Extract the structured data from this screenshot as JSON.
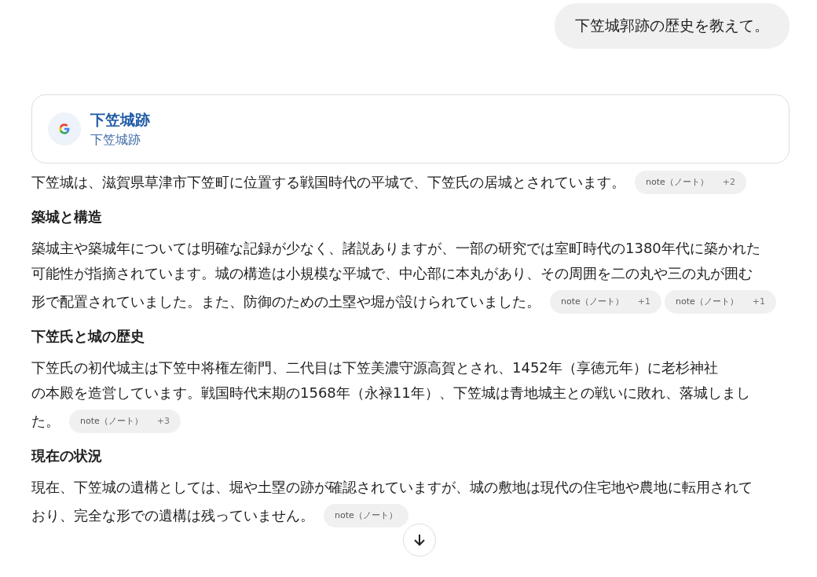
{
  "user_message": "下笠城郭跡の歴史を教えて。",
  "source_card": {
    "title": "下笠城跡",
    "subtitle": "下笠城跡"
  },
  "blocks": [
    {
      "kind": "para",
      "lines": [
        "下笠城は、滋賀県草津市下笠町に位置する戦国時代の平城で、下笠氏の居城とされています。"
      ],
      "citations": [
        {
          "source": "note（ノート）",
          "count": "+2"
        }
      ]
    },
    {
      "kind": "heading",
      "text": "築城と構造"
    },
    {
      "kind": "para",
      "lines": [
        "築城主や築城年については明確な記録が少なく、諸説ありますが、一部の研究では室町時代の1380年代に築かれた",
        "可能性が指摘されています。城の構造は小規模な平城で、中心部に本丸があり、その周囲を二の丸や三の丸が囲む",
        "形で配置されていました。また、防御のための土塁や堀が設けられていました。"
      ],
      "citations": [
        {
          "source": "note（ノート）",
          "count": "+1"
        },
        {
          "source": "note（ノート）",
          "count": "+1"
        }
      ]
    },
    {
      "kind": "heading",
      "text": "下笠氏と城の歴史"
    },
    {
      "kind": "para",
      "lines": [
        "下笠氏の初代城主は下笠中将権左衛門、二代目は下笠美濃守源高賀とされ、1452年（享徳元年）に老杉神社",
        "の本殿を造営しています。戦国時代末期の1568年（永禄11年）、下笠城は青地城主との戦いに敗れ、落城しまし",
        "た。"
      ],
      "citations": [
        {
          "source": "note（ノート）",
          "count": "+3"
        }
      ]
    },
    {
      "kind": "heading",
      "text": "現在の状況"
    },
    {
      "kind": "para",
      "lines": [
        "現在、下笠城の遺構としては、堀や土塁の跡が確認されていますが、城の敷地は現代の住宅地や農地に転用されて",
        "おり、完全な形での遺構は残っていません。"
      ],
      "citations": [
        {
          "source": "note（ノート）"
        }
      ]
    }
  ]
}
